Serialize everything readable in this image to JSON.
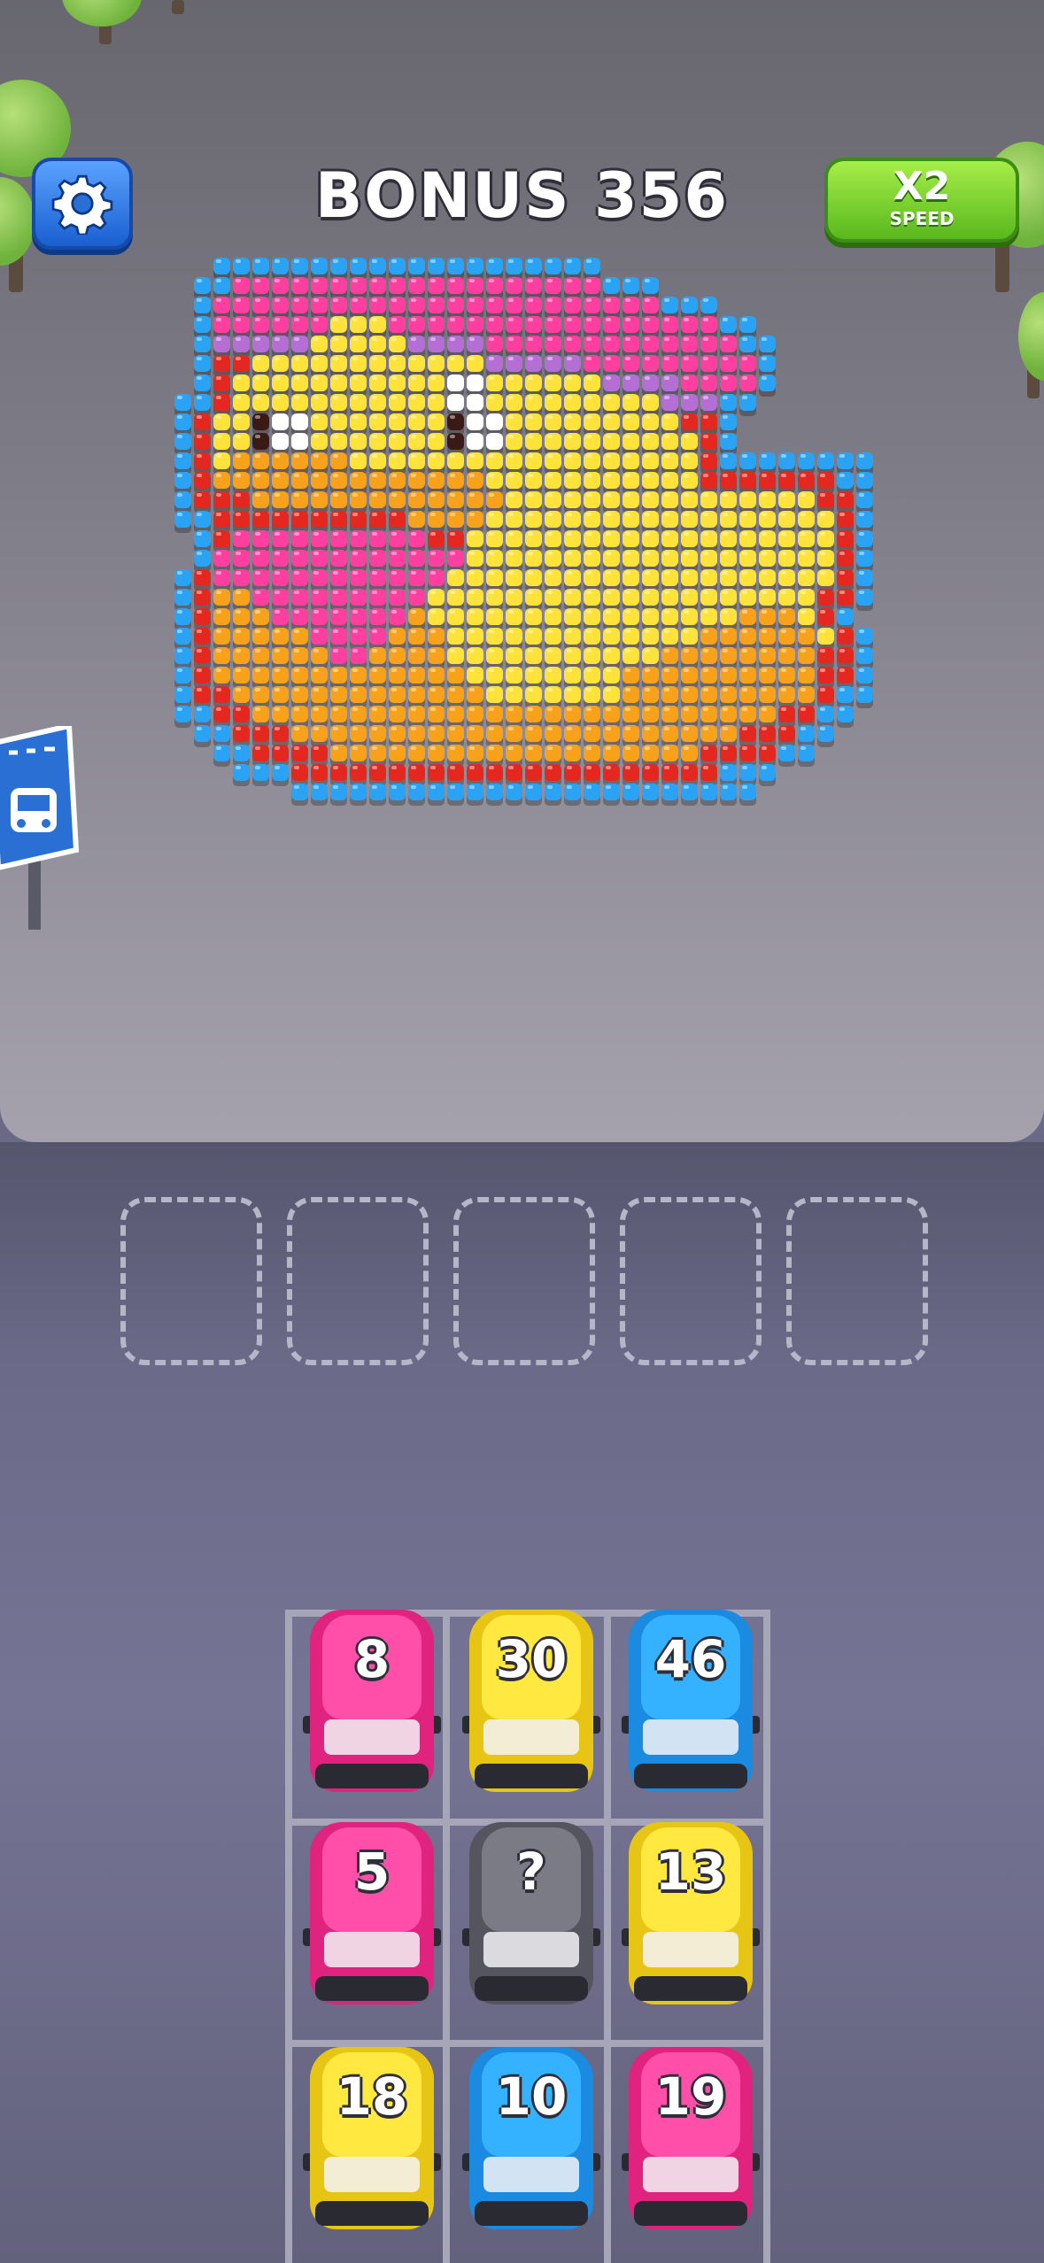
{
  "header": {
    "bonus_label": "BONUS 356",
    "speed_multiplier": "X2",
    "speed_label": "SPEED"
  },
  "colors": {
    "pink": "#ff3fa0",
    "yellow": "#ffe23a",
    "blue": "#2aa3f5",
    "orange": "#f7a21a",
    "red": "#e5281f",
    "purple": "#b56fd4",
    "gray": "#7b7b85",
    "dark": "#3a1a14",
    "white": "#ffffff"
  },
  "pixel_art": {
    "subject": "rubber duck",
    "rows": [
      "..BBBBBBBBBBBBBBBBBBBB..............",
      ".BBPPPPPPPPPPPPPPPPPPPBBB...........",
      ".BPPPPPPPPPPPPPPPPPPPPPPPBBB........",
      ".BPPPPPPYYYPPPPPPPPPPPPPPPPPBB......",
      ".BUUUUUYYYYYUUUUPPPPPPPPPPPPPBB.....",
      ".BRRYYYYYYYYYYYYUUUUUPPPPPPPPPB.....",
      ".BRYYYYYYYYYYYWWYYYYYYUUUUPPPPB.....",
      "BBRYYYYYYYYYYYWWYYYYYYYYYUUUBB......",
      "BRYYDWWYYYYYYYDWWYYYYYYYYYRRB.......",
      "BRYYDWWYYYYYYYDWWYYYYYYYYYYRB.......",
      "BRYOOOOOOYYYYYYYYYYYYYYYYYYRBBBBBBBB",
      "BROOOOOOOOOOOOOOYYYYYYYYYYYRRRRRRRBB",
      "BRRROOOOOOOOOOOOOYYYYYYYYYYYYYYYYRRB",
      "BBRRRRRRRRRROOOOYYYYYYYYYYYYYYYYYYRB",
      ".BRPPPPPPPPPPRRYYYYYYYYYYYYYYYYYYYRB",
      ".BPPPPPPPPPPPPPYYYYYYYYYYYYYYYYYYYRB",
      "BRPPPPPPPPPPPPYYYYYYYYYYYYYYYYYYYYRB",
      "BROOPPPPPPPPPYYYYYYYYYYYYYYYYYYYYRRB",
      "BROOOPPPPPPPOYYYYYYYYYYYYYYYYOOOYRB.",
      "BROOOOOPPPPOOOYYYYYYYYYYYYYOOOOOOYRB",
      "BROOOOOOPPOOOOYYYYYYYYYYYOOOOOOOORRB",
      "BROOOOOOOOOOOOOYYYYYYYYOOOOOOOOOORRB",
      "BRROOOOOOOOOOOOOYYYYYYYOOOOOOOOOORBB",
      "BBRROOOOOOOOOOOOOOOOOOOOOOOOOOORRBB.",
      ".BBRRROOOOOOOOOOOOOOOOOOOOOOORRRBB..",
      "..BBRRRROOOOOOOOOOOOOOOOOOORRRRBB...",
      "...BBBRRRRRRRRRRRRRRRRRRRRRRBBB.....",
      "......BBBBBBBBBBBBBBBBBBBBBBBB......"
    ]
  },
  "slots": [
    {
      "state": "empty"
    },
    {
      "state": "empty"
    },
    {
      "state": "empty"
    },
    {
      "state": "empty"
    },
    {
      "state": "empty"
    }
  ],
  "cars": [
    {
      "label": "8",
      "color": "pink"
    },
    {
      "label": "30",
      "color": "yellow"
    },
    {
      "label": "46",
      "color": "blue"
    },
    {
      "label": "5",
      "color": "pink"
    },
    {
      "label": "?",
      "color": "gray"
    },
    {
      "label": "13",
      "color": "yellow"
    },
    {
      "label": "18",
      "color": "yellow"
    },
    {
      "label": "10",
      "color": "blue"
    },
    {
      "label": "19",
      "color": "pink"
    }
  ]
}
